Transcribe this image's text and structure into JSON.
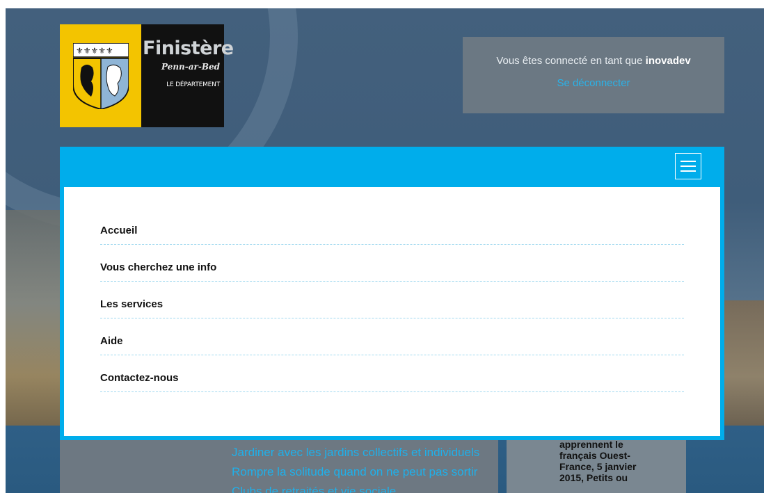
{
  "logo": {
    "title": "Finistère",
    "subtitle": "Penn-ar-Bed",
    "department": "LE DÉPARTEMENT"
  },
  "login": {
    "prefix": "Vous êtes connecté en tant que ",
    "username": "inovadev",
    "logout_label": "Se déconnecter"
  },
  "menu": {
    "toggle_icon": "hamburger-icon",
    "items": [
      {
        "label": "Accueil"
      },
      {
        "label": "Vous cherchez une info"
      },
      {
        "label": "Les services"
      },
      {
        "label": "Aide"
      },
      {
        "label": "Contactez-nous"
      }
    ]
  },
  "content": {
    "links": [
      {
        "label": "Jardiner avec les jardins collectifs et individuels"
      },
      {
        "label": "Rompre la solitude quand on ne peut pas sortir"
      },
      {
        "label": "Clubs de retraités et vie sociale"
      }
    ],
    "side_text": "apprennent le français Ouest-France, 5 janvier 2015, Petits ou"
  },
  "colors": {
    "accent": "#00adeb",
    "link": "#1fb0ea",
    "logo_yellow": "#f3c400"
  }
}
